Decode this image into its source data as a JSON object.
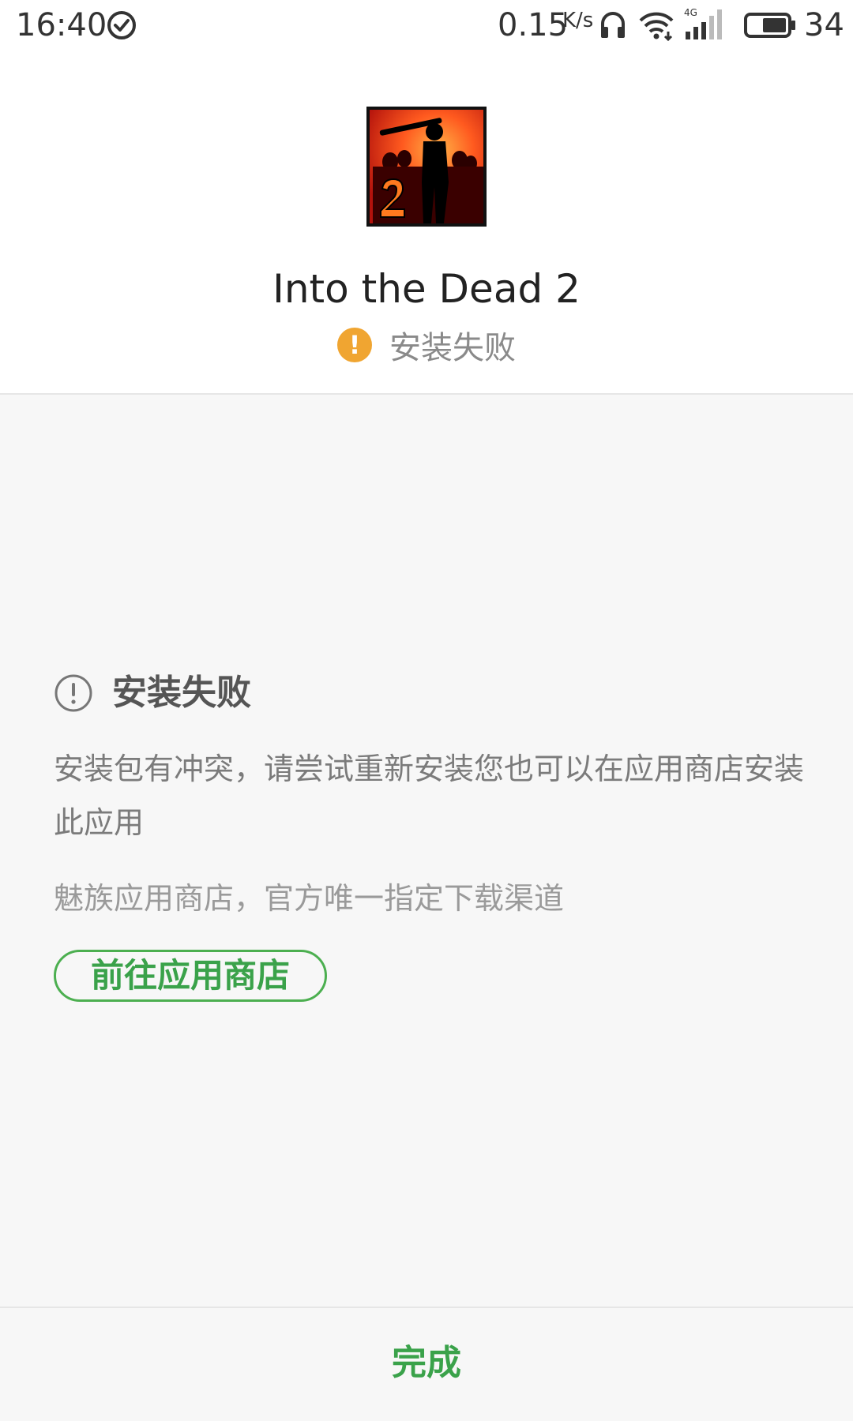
{
  "status_bar": {
    "time": "16:40",
    "network_speed": "0.15",
    "network_speed_unit": "K/s",
    "signal_type": "4G",
    "battery_percent": "34",
    "icons": [
      "check-circle-icon",
      "headset-icon",
      "wifi-icon",
      "signal-icon",
      "battery-icon"
    ]
  },
  "header": {
    "app_name": "Into the Dead 2",
    "status_label": "安装失败",
    "status_badge_symbol": "!",
    "status_color": "#f0a531"
  },
  "main": {
    "fail_title": "安装失败",
    "fail_description": "安装包有冲突，请尝试重新安装您也可以在应用商店安装此应用",
    "store_note": "魅族应用商店，官方唯一指定下载渠道",
    "store_button_label": "前往应用商店"
  },
  "footer": {
    "done_label": "完成"
  },
  "colors": {
    "accent": "#3aa24a",
    "warning": "#f0a531",
    "background": "#f7f7f7"
  }
}
